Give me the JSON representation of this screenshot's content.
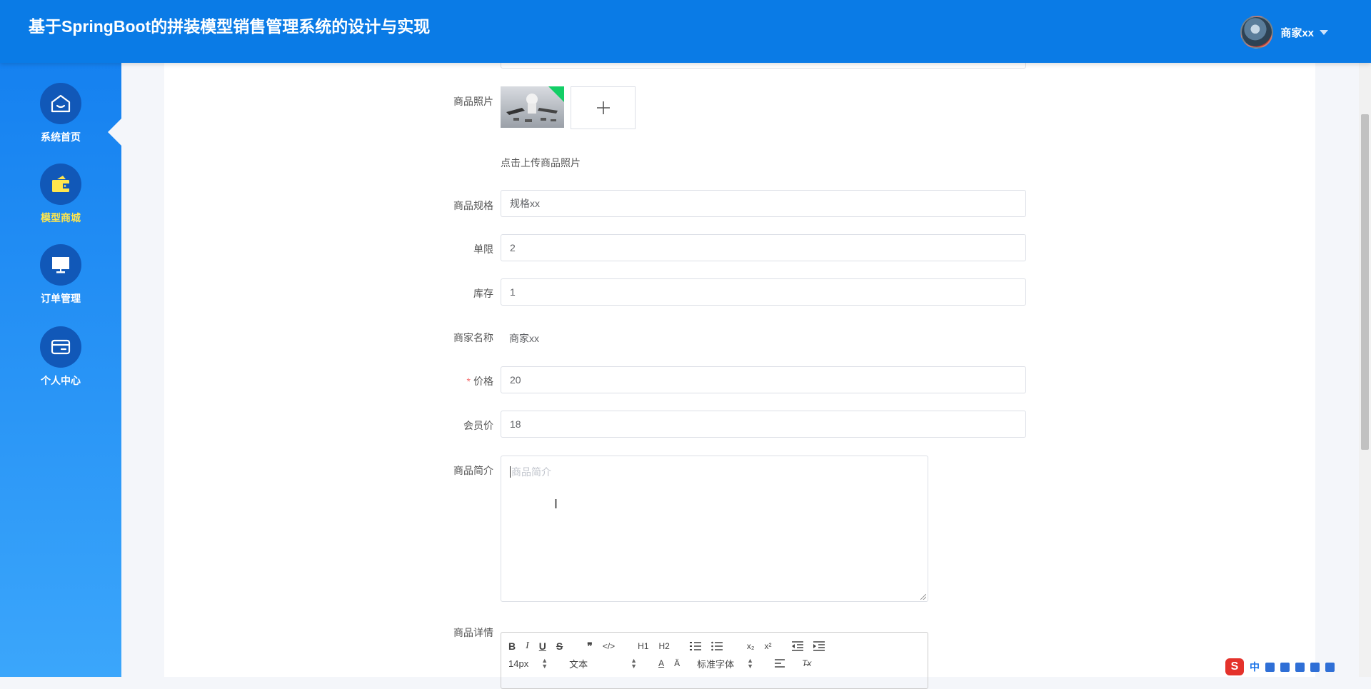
{
  "header": {
    "app_title": "基于SpringBoot的拼装模型销售管理系统的设计与实现",
    "user_name": "商家xx"
  },
  "sidebar": {
    "items": [
      {
        "label": "系统首页",
        "icon": "home-icon",
        "active": false
      },
      {
        "label": "模型商城",
        "icon": "wallet-icon",
        "active": true
      },
      {
        "label": "订单管理",
        "icon": "monitor-icon",
        "active": false
      },
      {
        "label": "个人中心",
        "icon": "card-icon",
        "active": false
      }
    ],
    "active_color": "#ffe64d"
  },
  "form": {
    "photo": {
      "label": "商品照片",
      "hint": "点击上传商品照片"
    },
    "spec": {
      "label": "商品规格",
      "value": "规格xx"
    },
    "limit": {
      "label": "单限",
      "value": "2"
    },
    "stock": {
      "label": "库存",
      "value": "1"
    },
    "merchant": {
      "label": "商家名称",
      "value": "商家xx"
    },
    "price": {
      "label": "价格",
      "required_mark": "*",
      "value": "20"
    },
    "member_price": {
      "label": "会员价",
      "value": "18"
    },
    "intro": {
      "label": "商品简介",
      "placeholder": "商品简介"
    },
    "detail": {
      "label": "商品详情",
      "toolbar_row1": [
        "B",
        "I",
        "U",
        "S",
        "❞",
        "</>",
        "H1",
        "H2",
        "ol",
        "ul",
        "x₂",
        "x²",
        "outdent",
        "indent"
      ],
      "font_size": "14px",
      "text_type": "文本",
      "font_family": "标准字体"
    }
  },
  "ime": {
    "logo": "S",
    "mode": "中"
  },
  "colors": {
    "header": "#0a7be6",
    "sidebar_top": "#1581f0",
    "sidebar_bottom": "#3ba6fb",
    "required": "#f56c6c"
  }
}
